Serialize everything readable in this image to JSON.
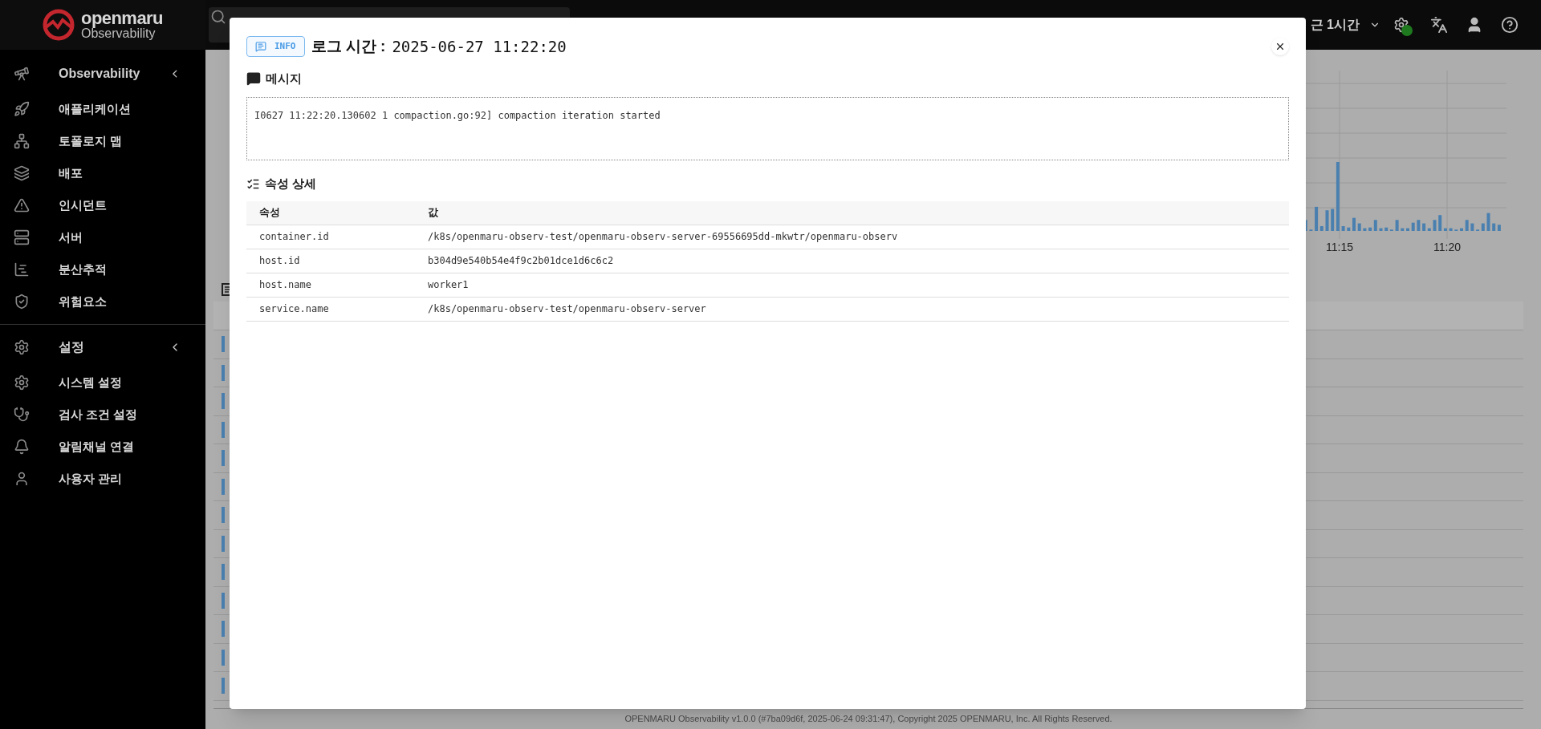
{
  "brand": {
    "name": "openmaru",
    "product": "Observability"
  },
  "sidebar": {
    "groups": [
      {
        "label": "Observability",
        "expanded": true,
        "items": [
          {
            "label": "애플리케이션"
          },
          {
            "label": "토폴로지 맵"
          },
          {
            "label": "배포"
          },
          {
            "label": "인시던트"
          },
          {
            "label": "서버"
          },
          {
            "label": "분산추적"
          },
          {
            "label": "위험요소"
          }
        ]
      },
      {
        "label": "설정",
        "expanded": true,
        "items": [
          {
            "label": "시스템 설정"
          },
          {
            "label": "검사 조건 설정"
          },
          {
            "label": "알림채널 연결"
          },
          {
            "label": "사용자 관리"
          }
        ]
      }
    ]
  },
  "topbar": {
    "time_range": "근 1시간",
    "online": true
  },
  "chart": {
    "x_labels": [
      "11:15",
      "11:20"
    ]
  },
  "modal": {
    "level": "INFO",
    "title_label": "로그 시간 :",
    "time": "2025-06-27 11:22:20",
    "message_heading": "메시지",
    "message": "I0627 11:22:20.130602 1 compaction.go:92] compaction iteration started",
    "attributes_heading": "속성 상세",
    "columns": [
      "속성",
      "값"
    ],
    "rows": [
      [
        "container.id",
        "/k8s/openmaru-observ-test/openmaru-observ-server-69556695dd-mkwtr/openmaru-observ"
      ],
      [
        "host.id",
        "b304d9e540b54e4f9c2b01dce1d6c6c2"
      ],
      [
        "host.name",
        "worker1"
      ],
      [
        "service.name",
        "/k8s/openmaru-observ-test/openmaru-observ-server"
      ]
    ]
  },
  "footer": "OPENMARU Observability v1.0.0 (#7ba09d6f, 2025-06-24 09:31:47), Copyright 2025 OPENMARU, Inc. All Rights Reserved."
}
